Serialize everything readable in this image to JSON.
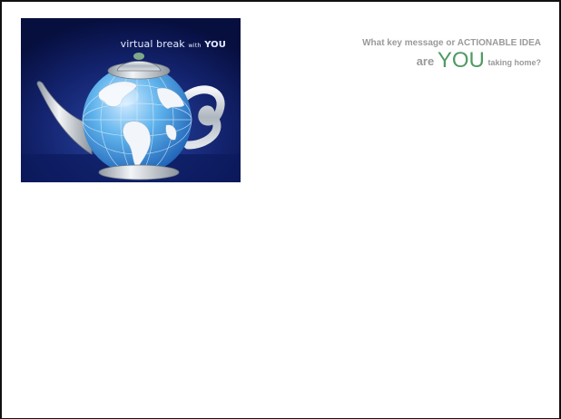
{
  "slide": {
    "image": {
      "caption_main": "virtual break",
      "caption_small": "with",
      "caption_end": "YOU",
      "depicts": "teapot-globe-illustration"
    },
    "prompt": {
      "line1": "What key message or ACTIONABLE IDEA",
      "line2_start": "are",
      "line2_emphasis": "YOU",
      "line2_end": "taking home?"
    }
  },
  "colors": {
    "border": "#111111",
    "prompt_text": "#9a9a9a",
    "emphasis": "#4f9a62",
    "image_background": "#0a1550"
  }
}
